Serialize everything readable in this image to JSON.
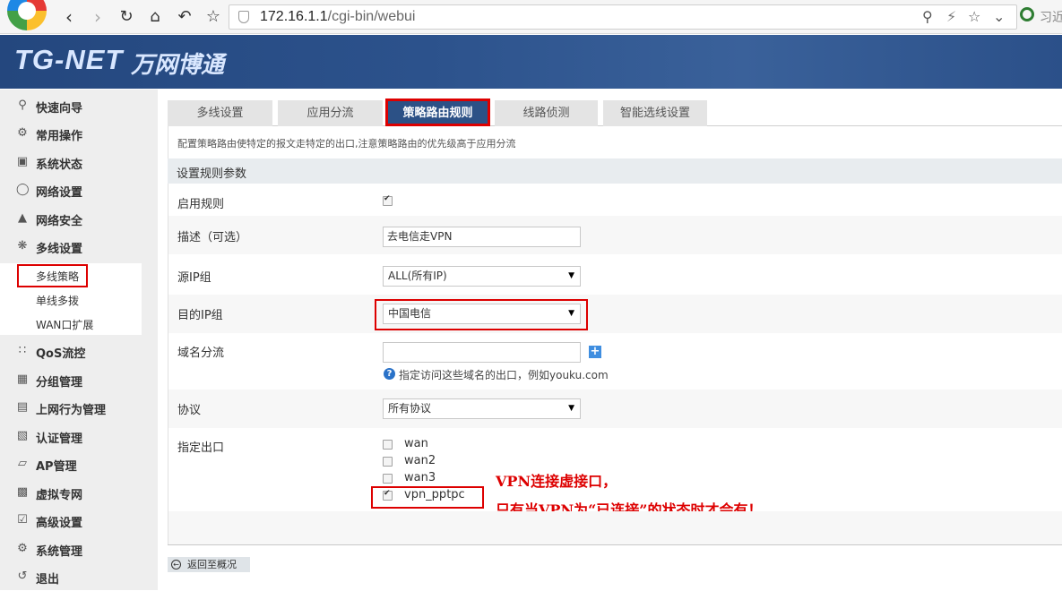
{
  "browser": {
    "url_host": "172.16.1.1",
    "url_path": "/cgi-bin/webui",
    "search_hint": "习近"
  },
  "header": {
    "brand_en": "TG-NET",
    "brand_cn": "万网博通"
  },
  "sidebar": {
    "items": [
      {
        "label": "快速向导",
        "icon": "wand-icon"
      },
      {
        "label": "常用操作",
        "icon": "wrench-icon"
      },
      {
        "label": "系统状态",
        "icon": "monitor-icon"
      },
      {
        "label": "网络设置",
        "icon": "globe-icon"
      },
      {
        "label": "网络安全",
        "icon": "shield-icon"
      },
      {
        "label": "多线设置",
        "icon": "network-icon"
      },
      {
        "label": "QoS流控",
        "icon": "flow-icon"
      },
      {
        "label": "分组管理",
        "icon": "group-icon"
      },
      {
        "label": "上网行为管理",
        "icon": "document-icon"
      },
      {
        "label": "认证管理",
        "icon": "id-card-icon"
      },
      {
        "label": "AP管理",
        "icon": "folder-icon"
      },
      {
        "label": "虚拟专网",
        "icon": "lock-icon"
      },
      {
        "label": "高级设置",
        "icon": "check-icon"
      },
      {
        "label": "系统管理",
        "icon": "gear-icon"
      },
      {
        "label": "退出",
        "icon": "logout-icon"
      }
    ],
    "submenu": [
      "多线策略",
      "单线多拨",
      "WAN口扩展"
    ]
  },
  "tabs": [
    "多线设置",
    "应用分流",
    "策略路由规则",
    "线路侦测",
    "智能选线设置"
  ],
  "main": {
    "description": "配置策略路由使特定的报文走特定的出口,注意策略路由的优先级高于应用分流",
    "section_title": "设置规则参数",
    "enable_label": "启用规则",
    "desc_label": "描述（可选）",
    "desc_value": "去电信走VPN",
    "src_label": "源IP组",
    "src_value": "ALL(所有IP)",
    "dst_label": "目的IP组",
    "dst_value": "中国电信",
    "domain_label": "域名分流",
    "domain_help": "指定访问这些域名的出口，例如youku.com",
    "proto_label": "协议",
    "proto_value": "所有协议",
    "exit_label": "指定出口",
    "exits": [
      {
        "name": "wan",
        "checked": false
      },
      {
        "name": "wan2",
        "checked": false
      },
      {
        "name": "wan3",
        "checked": false
      },
      {
        "name": "vpn_pptpc",
        "checked": true
      }
    ],
    "annotation_line1": "VPN连接虚接口，",
    "annotation_line2": "只有当VPN为“已连接”的状态时才会有！",
    "back_label": "返回至概况"
  }
}
